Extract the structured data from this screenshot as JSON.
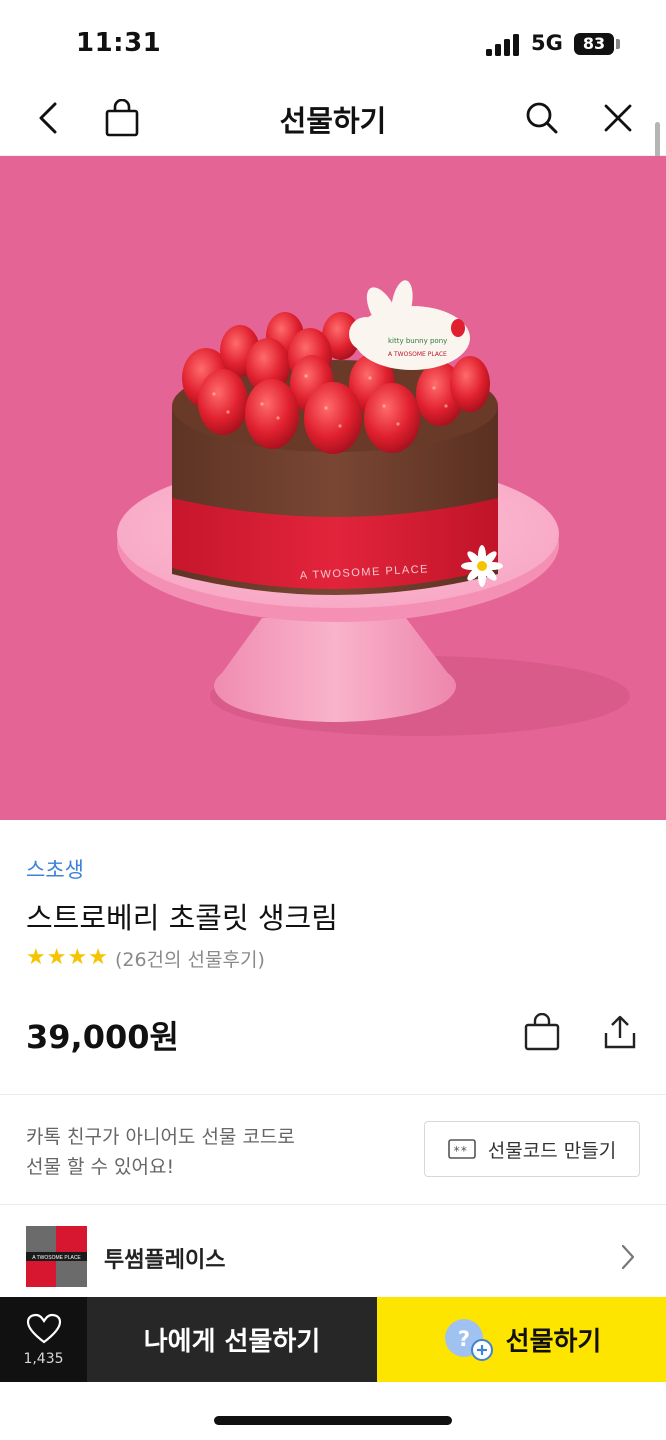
{
  "status_bar": {
    "time": "11:31",
    "network": "5G",
    "battery": "83"
  },
  "header": {
    "title": "선물하기"
  },
  "hero": {
    "ribbon_text": "A TWOSOME PLACE",
    "topper_line1": "kitty bunny pony",
    "topper_line2": "A TWOSOME PLACE"
  },
  "product": {
    "brand": "스초생",
    "name": "스트로베리 초콜릿 생크림",
    "rating_stars": 4,
    "review_text": "(26건의 선물후기)",
    "price": "39,000원"
  },
  "gift_code": {
    "message_line1": "카톡 친구가 아니어도 선물 코드로",
    "message_line2": "선물 할 수 있어요!",
    "button_icon_text": "**",
    "button_label": "선물코드 만들기"
  },
  "store": {
    "name": "투썸플레이스",
    "logo_text": "A TWOSOME PLACE"
  },
  "bottom_bar": {
    "like_count": "1,435",
    "self_gift_label": "나에게 선물하기",
    "gift_icon_text": "?",
    "gift_label": "선물하기"
  },
  "colors": {
    "hero_bg": "#e46595",
    "brand_link": "#3d83d8",
    "star": "#f5c400",
    "gift_button": "#fee500",
    "dark_button": "#272727"
  }
}
